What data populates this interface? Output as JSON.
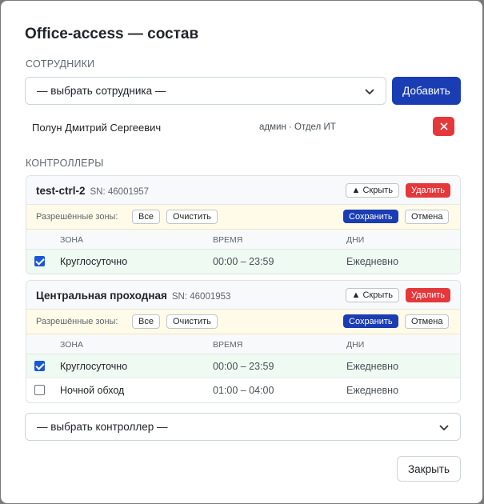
{
  "modal": {
    "title": "Office-access — состав",
    "close_label": "Закрыть"
  },
  "employees": {
    "section_label": "СОТРУДНИКИ",
    "select_placeholder": "— выбрать сотрудника —",
    "add_label": "Добавить",
    "items": [
      {
        "name": "Полун Дмитрий Сергеевич",
        "meta": "админ · Отдел ИТ",
        "remove_icon": "close-icon"
      }
    ]
  },
  "controllers": {
    "section_label": "КОНТРОЛЛЕРЫ",
    "select_placeholder": "— выбрать контроллер —",
    "zones_label": "Разрешённые зоны:",
    "all_label": "Все",
    "clear_label": "Очистить",
    "save_label": "Сохранить",
    "cancel_label": "Отмена",
    "hide_label": "▲ Скрыть",
    "delete_label": "Удалить",
    "columns": {
      "zone": "ЗОНА",
      "time": "ВРЕМЯ",
      "days": "ДНИ"
    },
    "items": [
      {
        "name": "test-ctrl-2",
        "sn": "SN: 46001957",
        "zones": [
          {
            "zone": "Круглосуточно",
            "time": "00:00 – 23:59",
            "days": "Ежедневно",
            "checked": true
          }
        ]
      },
      {
        "name": "Центральная проходная",
        "sn": "SN: 46001953",
        "zones": [
          {
            "zone": "Круглосуточно",
            "time": "00:00 – 23:59",
            "days": "Ежедневно",
            "checked": true
          },
          {
            "zone": "Ночной обход",
            "time": "01:00 – 04:00",
            "days": "Ежедневно",
            "checked": false
          }
        ]
      }
    ]
  },
  "colors": {
    "primary": "#1a3db3",
    "danger": "#e5383b",
    "zones_bar_bg": "#fffbe8",
    "checked_row_bg": "#effaf2"
  }
}
